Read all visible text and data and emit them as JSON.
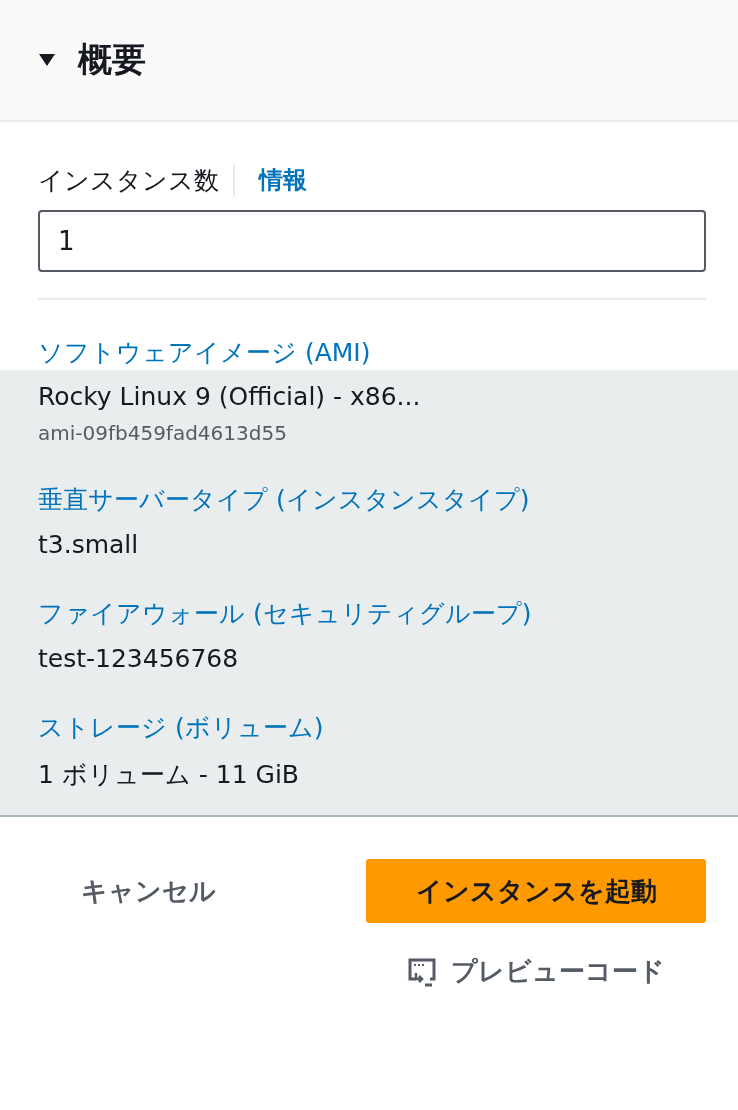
{
  "panel": {
    "title": "概要",
    "expanded": true
  },
  "instance_count": {
    "label": "インスタンス数",
    "info_link": "情報",
    "value": "1"
  },
  "summary": [
    {
      "label": "ソフトウェアイメージ (AMI)",
      "value": "Rocky Linux 9 (Official) - x86...",
      "sub": "ami-09fb459fad4613d55"
    },
    {
      "label": "垂直サーバータイプ (インスタンスタイプ)",
      "value": "t3.small"
    },
    {
      "label": "ファイアウォール (セキュリティグループ)",
      "value": "test-123456768"
    },
    {
      "label": "ストレージ (ボリューム)",
      "value": "1 ボリューム - 11 GiB"
    }
  ],
  "buttons": {
    "cancel": "キャンセル",
    "launch": "インスタンスを起動",
    "preview": "プレビューコード"
  }
}
